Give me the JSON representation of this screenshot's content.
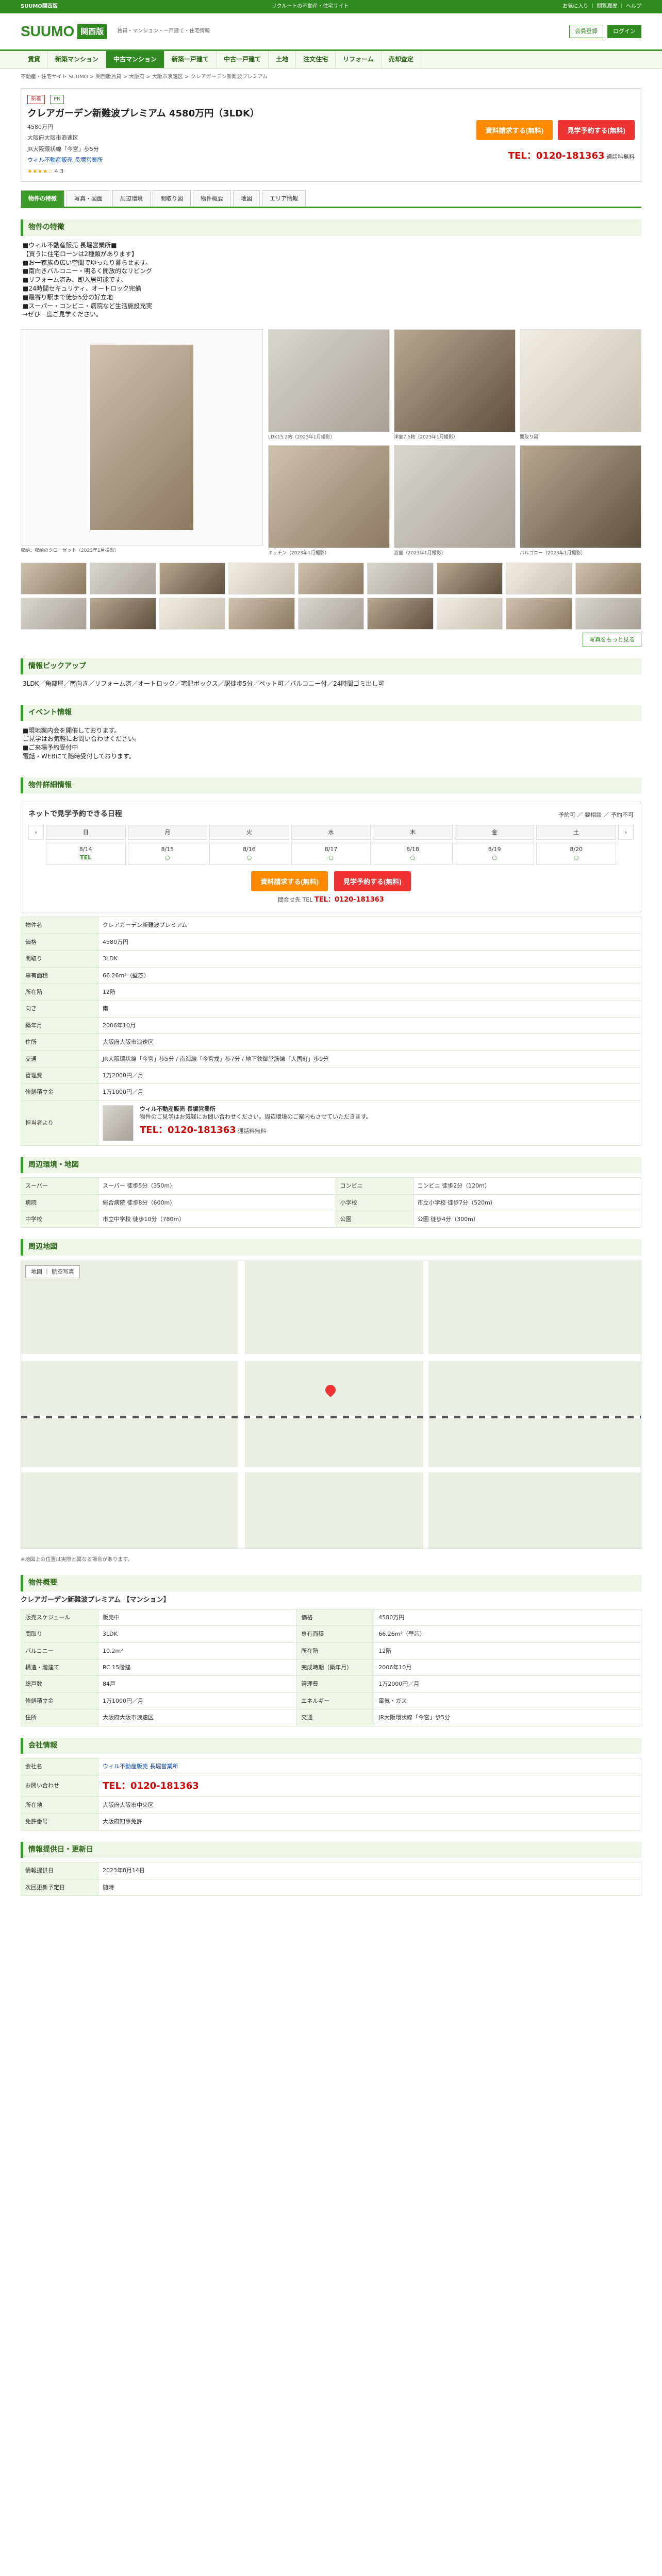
{
  "topbar": {
    "brand": "SUUMO関西版",
    "tagline": "リクルートの不動産・住宅サイト",
    "links": [
      "お気に入り",
      "閲覧履歴",
      "ヘルプ"
    ]
  },
  "header": {
    "region": "関西版",
    "tagline": "賃貸・マンション・一戸建て・住宅情報",
    "register": "会員登録",
    "login": "ログイン"
  },
  "nav": [
    "賃貸",
    "新築マンション",
    "中古マンション",
    "新築一戸建て",
    "中古一戸建て",
    "土地",
    "注文住宅",
    "リフォーム",
    "売却査定"
  ],
  "breadcrumb": "不動産・住宅サイト SUUMO > 関西版賃貸 > 大阪府 > 大阪市浪速区 > クレアガーデン新難波プレミアム",
  "listing": {
    "title": "クレアガーデン新難波プレミアム 4580万円（3LDK）",
    "badge1": "新着",
    "badge2": "PR",
    "price": "4580万円",
    "line1": "大阪府大阪市浪速区",
    "line2": "JR大阪環状線「今宮」歩5分",
    "company": "ウィル不動産販売 長堀営業所",
    "rating": "4.3",
    "cta_request": "資料請求する(無料)",
    "cta_visit": "見学予約する(無料)",
    "tel": "TEL：0120-181363",
    "tel_note": "通話料無料"
  },
  "tabs": [
    "物件の特徴",
    "写真・図面",
    "周辺環境",
    "間取り図",
    "物件概要",
    "地図",
    "エリア情報"
  ],
  "features": {
    "heading": "物件の特徴",
    "text": "■ウィル不動産販売 長堀営業所■\n【買うに住宅ローンは2種類があります】\n■お一家族の広い空間でゆったり暮らせます。\n■南向きバルコニー・明るく開放的なリビング\n■リフォーム済み、即入居可能です。\n■24時間セキュリティ、オートロック完備\n■最寄り駅まで徒歩5分の好立地\n■スーパー・コンビニ・病院など生活施設充実\n→ぜひ一度ご見学ください。"
  },
  "photos": {
    "main_caption": "収納：収納のクローゼット（2023年1月撮影）",
    "captions": [
      "LDK15.2帖（2023年1月撮影）",
      "洋室7.5帖（2023年1月撮影）",
      "間取り図",
      "キッチン（2023年1月撮影）",
      "浴室（2023年1月撮影）",
      "バルコニー（2023年1月撮影）"
    ],
    "more": "写真をもっと見る"
  },
  "pickup": {
    "heading": "情報ピックアップ",
    "text": "3LDK／角部屋／南向き／リフォーム済／オートロック／宅配ボックス／駅徒歩5分／ペット可／バルコニー付／24時間ゴミ出し可"
  },
  "event": {
    "heading": "イベント情報",
    "text": "■現地案内会を開催しております。\nご見学はお気軽にお問い合わせください。\n■ご来場予約受付中\n電話・WEBにて随時受付しております。"
  },
  "schedule": {
    "heading": "物件詳細情報",
    "cal_title": "ネットで見学予約できる日程",
    "legend": [
      "予約可",
      "要相談",
      "予約不可"
    ],
    "days": [
      "日",
      "月",
      "火",
      "水",
      "木",
      "金",
      "土"
    ],
    "dates": [
      "8/14",
      "8/15",
      "8/16",
      "8/17",
      "8/18",
      "8/19",
      "8/20"
    ],
    "marks": [
      "TEL",
      "○",
      "○",
      "○",
      "○",
      "○",
      "○"
    ],
    "cta_request": "資料請求する(無料)",
    "cta_visit": "見学予約する(無料)",
    "tel_label": "問合せ先 TEL",
    "tel": "TEL：0120-181363"
  },
  "detail_rows": [
    {
      "k": "物件名",
      "v": "クレアガーデン新難波プレミアム"
    },
    {
      "k": "価格",
      "v": "4580万円"
    },
    {
      "k": "間取り",
      "v": "3LDK"
    },
    {
      "k": "専有面積",
      "v": "66.26m²（壁芯）"
    },
    {
      "k": "所在階",
      "v": "12階"
    },
    {
      "k": "向き",
      "v": "南"
    },
    {
      "k": "築年月",
      "v": "2006年10月"
    },
    {
      "k": "住所",
      "v": "大阪府大阪市浪速区"
    },
    {
      "k": "交通",
      "v": "JR大阪環状線「今宮」歩5分 / 南海線「今宮戎」歩7分 / 地下鉄御堂筋線「大国町」歩9分"
    },
    {
      "k": "管理費",
      "v": "1万2000円／月"
    },
    {
      "k": "修繕積立金",
      "v": "1万1000円／月"
    }
  ],
  "agent": {
    "heading": "担当者より",
    "name": "ウィル不動産販売 長堀営業所",
    "comment": "物件のご見学はお気軽にお問い合わせください。周辺環境のご案内もさせていただきます。",
    "tel": "TEL：0120-181363",
    "tel_note": "通話料無料"
  },
  "surroundings": {
    "heading": "周辺環境・地図",
    "rows": [
      {
        "k": "スーパー",
        "v": "スーパー 徒歩5分（350m）"
      },
      {
        "k": "コンビニ",
        "v": "コンビニ 徒歩2分（120m）"
      },
      {
        "k": "病院",
        "v": "総合病院 徒歩8分（600m）"
      },
      {
        "k": "小学校",
        "v": "市立小学校 徒歩7分（520m）"
      },
      {
        "k": "中学校",
        "v": "市立中学校 徒歩10分（780m）"
      },
      {
        "k": "公園",
        "v": "公園 徒歩4分（300m）"
      }
    ]
  },
  "map": {
    "heading": "周辺地図",
    "ctrl_map": "地図",
    "ctrl_photo": "航空写真",
    "note": "※地図上の位置は実際と異なる場合があります。"
  },
  "overview": {
    "heading": "物件概要",
    "name": "クレアガーデン新難波プレミアム 【マンション】",
    "rows": [
      {
        "k": "販売スケジュール",
        "v": "販売中"
      },
      {
        "k": "価格",
        "v": "4580万円"
      },
      {
        "k": "間取り",
        "v": "3LDK"
      },
      {
        "k": "専有面積",
        "v": "66.26m²（壁芯）"
      },
      {
        "k": "バルコニー",
        "v": "10.2m²"
      },
      {
        "k": "所在階",
        "v": "12階"
      },
      {
        "k": "構造・階建て",
        "v": "RC 15階建"
      },
      {
        "k": "完成時期（築年月）",
        "v": "2006年10月"
      },
      {
        "k": "総戸数",
        "v": "84戸"
      },
      {
        "k": "管理費",
        "v": "1万2000円／月"
      },
      {
        "k": "修繕積立金",
        "v": "1万1000円／月"
      },
      {
        "k": "エネルギー",
        "v": "電気・ガス"
      },
      {
        "k": "住所",
        "v": "大阪府大阪市浪速区"
      },
      {
        "k": "交通",
        "v": "JR大阪環状線「今宮」歩5分"
      }
    ]
  },
  "company": {
    "heading": "会社情報",
    "rows": [
      {
        "k": "会社名",
        "v": "ウィル不動産販売 長堀営業所"
      },
      {
        "k": "お問い合わせ",
        "v": "TEL：0120-181363"
      },
      {
        "k": "所在地",
        "v": "大阪府大阪市中央区"
      },
      {
        "k": "免許番号",
        "v": "大阪府知事免許"
      }
    ]
  },
  "info": {
    "heading": "情報提供日・更新日",
    "rows": [
      {
        "k": "情報提供日",
        "v": "2023年8月14日"
      },
      {
        "k": "次回更新予定日",
        "v": "随時"
      }
    ]
  }
}
